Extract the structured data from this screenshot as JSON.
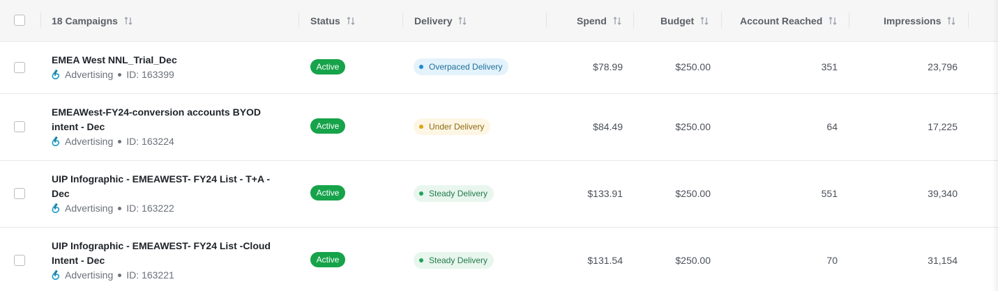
{
  "header": {
    "campaigns": "18 Campaigns",
    "status": "Status",
    "delivery": "Delivery",
    "spend": "Spend",
    "budget": "Budget",
    "account_reached": "Account Reached",
    "impressions": "Impressions"
  },
  "colors": {
    "active": "#16a34a",
    "overpaced": "#1d8ad4",
    "under": "#e0a316",
    "steady": "#1ea35b"
  },
  "rows": [
    {
      "name_line1": "EMEA West NNL_Trial_Dec",
      "name_line2": "",
      "type": "Advertising",
      "id": "ID: 163399",
      "status": "Active",
      "delivery": "Overpaced Delivery",
      "spend": "$78.99",
      "budget": "$250.00",
      "accounts": "351",
      "impressions": "23,796"
    },
    {
      "name_line1": "EMEAWest-FY24-conversion accounts BYOD",
      "name_line2": "intent - Dec",
      "type": "Advertising",
      "id": "ID: 163224",
      "status": "Active",
      "delivery": "Under Delivery",
      "spend": "$84.49",
      "budget": "$250.00",
      "accounts": "64",
      "impressions": "17,225"
    },
    {
      "name_line1": "UIP Infographic - EMEAWEST- FY24 List - T+A -",
      "name_line2": "Dec",
      "type": "Advertising",
      "id": "ID: 163222",
      "status": "Active",
      "delivery": "Steady Delivery",
      "spend": "$133.91",
      "budget": "$250.00",
      "accounts": "551",
      "impressions": "39,340"
    },
    {
      "name_line1": "UIP Infographic - EMEAWEST- FY24 List -Cloud",
      "name_line2": "Intent - Dec",
      "type": "Advertising",
      "id": "ID: 163221",
      "status": "Active",
      "delivery": "Steady Delivery",
      "spend": "$131.54",
      "budget": "$250.00",
      "accounts": "70",
      "impressions": "31,154"
    }
  ]
}
